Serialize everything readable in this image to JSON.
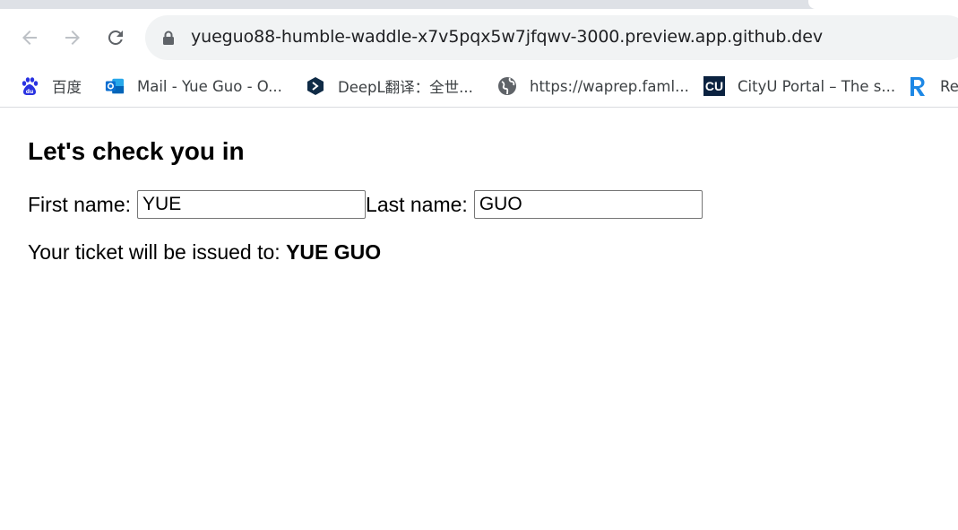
{
  "browser": {
    "url": "yueguo88-humble-waddle-x7v5pqx5w7jfqwv-3000.preview.app.github.dev"
  },
  "bookmarks": [
    {
      "label": "百度",
      "icon": "baidu-paw-icon"
    },
    {
      "label": "Mail - Yue Guo - O...",
      "icon": "outlook-icon"
    },
    {
      "label": "DeepL翻译：全世...",
      "icon": "deepl-icon"
    },
    {
      "label": "https://waprep.faml...",
      "icon": "globe-icon"
    },
    {
      "label": "CityU Portal – The s...",
      "icon": "cityu-icon",
      "badge": "CU"
    },
    {
      "label": "Re",
      "icon": "r-logo-icon"
    }
  ],
  "page": {
    "heading": "Let's check you in",
    "first_name_label": "First name:",
    "first_name_value": "YUE",
    "last_name_label": "Last name:",
    "last_name_value": "GUO",
    "ticket_prefix": "Your ticket will be issued to: ",
    "ticket_name": "YUE GUO"
  },
  "colors": {
    "accent_blue": "#1a73e8",
    "omnibox_bg": "#f1f3f4",
    "cityu_bg": "#0b2240"
  }
}
